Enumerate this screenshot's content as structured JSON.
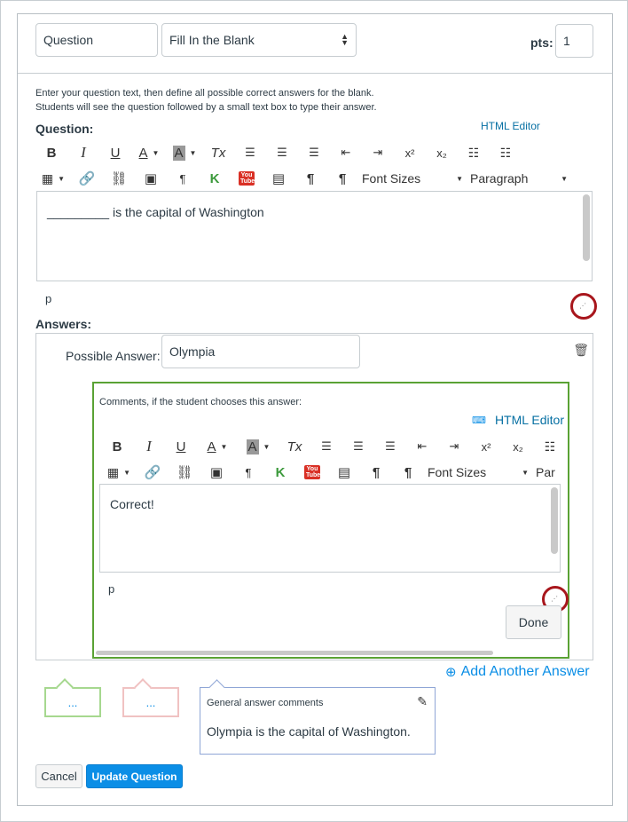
{
  "header": {
    "question_name": "Question",
    "question_type": "Fill In the Blank",
    "points_label": "pts:",
    "points_value": "1"
  },
  "instructions": {
    "line1": "Enter your question text, then define all possible correct answers for the blank.",
    "line2": "Students will see the question followed by a small text box to type their answer."
  },
  "question_editor": {
    "label": "Question:",
    "html_editor_link": "HTML Editor",
    "font_sizes_label": "Font Sizes",
    "paragraph_label": "Paragraph",
    "content": "_________ is the capital of Washington",
    "path": "p"
  },
  "answers": {
    "label": "Answers:",
    "possible_answer_label": "Possible Answer:",
    "possible_answer_value": "Olympia",
    "comments_label": "Comments, if the student chooses this answer:",
    "html_editor_link": "HTML Editor",
    "font_sizes_label": "Font Sizes",
    "paragraph_label_partial": "Par",
    "comment_content": "Correct!",
    "comment_path": "p",
    "done_label": "Done",
    "add_another_label": "Add Another Answer"
  },
  "feedback_tabs": {
    "correct_placeholder": "...",
    "incorrect_placeholder": "...",
    "general_label": "General answer comments",
    "general_text": "Olympia is the capital of Washington."
  },
  "footer": {
    "cancel_label": "Cancel",
    "update_label": "Update Question"
  },
  "toolbar_glyphs": {
    "bold": "B",
    "italic": "I",
    "underline": "U",
    "font_color": "A",
    "bg_color": "A",
    "clear_format": "Tx",
    "superscript": "x²",
    "subscript": "x₂",
    "pilcrow": "¶",
    "youtube": "You Tube"
  },
  "colors": {
    "accent": "#0b8ee6",
    "correct": "#5aa234",
    "incorrect": "#e8a0a0",
    "highlight": "#a8161c"
  }
}
